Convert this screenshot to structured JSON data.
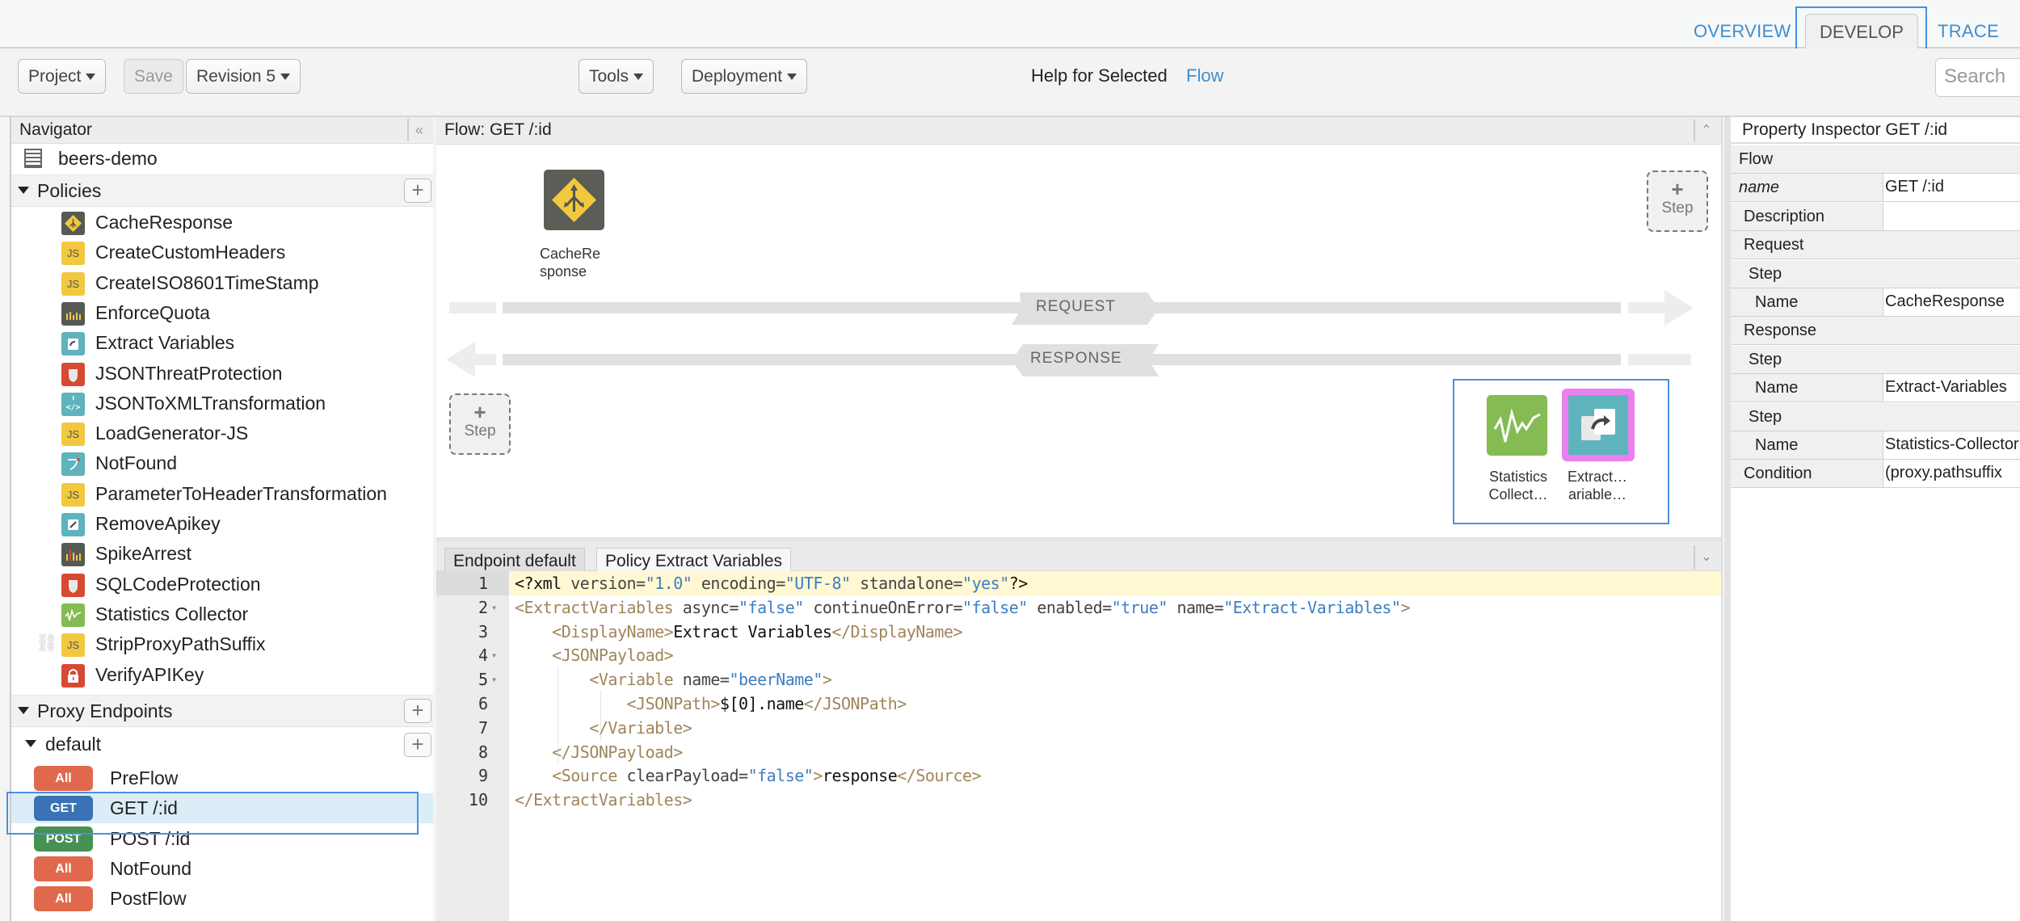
{
  "top_tabs": {
    "overview": "OVERVIEW",
    "develop": "DEVELOP",
    "trace": "TRACE",
    "active": "DEVELOP"
  },
  "toolbar": {
    "project": "Project",
    "save": "Save",
    "revision": "Revision 5",
    "tools": "Tools",
    "deployment": "Deployment",
    "help_label": "Help for Selected",
    "help_link": "Flow",
    "search_placeholder": "Search"
  },
  "navigator": {
    "title": "Navigator",
    "proxy_name": "beers-demo",
    "policies_label": "Policies",
    "policies": [
      {
        "label": "CacheResponse",
        "icon": "cache-response-icon"
      },
      {
        "label": "CreateCustomHeaders",
        "icon": "javascript-icon"
      },
      {
        "label": "CreateISO8601TimeStamp",
        "icon": "javascript-icon"
      },
      {
        "label": "EnforceQuota",
        "icon": "quota-icon"
      },
      {
        "label": "Extract Variables",
        "icon": "extract-variables-icon"
      },
      {
        "label": "JSONThreatProtection",
        "icon": "shield-icon"
      },
      {
        "label": "JSONToXMLTransformation",
        "icon": "code-transform-icon"
      },
      {
        "label": "LoadGenerator-JS",
        "icon": "javascript-icon"
      },
      {
        "label": "NotFound",
        "icon": "raise-fault-icon"
      },
      {
        "label": "ParameterToHeaderTransformation",
        "icon": "javascript-icon"
      },
      {
        "label": "RemoveApikey",
        "icon": "assign-message-icon"
      },
      {
        "label": "SpikeArrest",
        "icon": "spike-arrest-icon"
      },
      {
        "label": "SQLCodeProtection",
        "icon": "shield-icon"
      },
      {
        "label": "Statistics Collector",
        "icon": "statistics-icon"
      },
      {
        "label": "StripProxyPathSuffix",
        "icon": "javascript-icon"
      },
      {
        "label": "VerifyAPIKey",
        "icon": "lock-icon"
      }
    ],
    "proxy_endpoints_label": "Proxy Endpoints",
    "endpoint_name": "default",
    "flows": [
      {
        "verb": "All",
        "label": "PreFlow"
      },
      {
        "verb": "GET",
        "label": "GET /:id",
        "selected": true
      },
      {
        "verb": "POST",
        "label": "POST /:id"
      },
      {
        "verb": "All",
        "label": "NotFound"
      },
      {
        "verb": "All",
        "label": "PostFlow"
      }
    ]
  },
  "flow_panel": {
    "title": "Flow: GET /:id",
    "request_label": "REQUEST",
    "response_label": "RESPONSE",
    "step_label": "Step",
    "request_steps": [
      {
        "label_line1": "CacheRe",
        "label_line2": "sponse"
      }
    ],
    "response_steps": [
      {
        "label_line1": "Statistics",
        "label_line2": "Collect…"
      },
      {
        "label_line1": "Extract…",
        "label_line2": "ariable…",
        "selected": true
      }
    ]
  },
  "editor": {
    "tabs": [
      "Endpoint default",
      "Policy Extract Variables"
    ],
    "active_tab": "Policy Extract Variables",
    "lines": [
      "<?xml version=\"1.0\" encoding=\"UTF-8\" standalone=\"yes\"?>",
      "<ExtractVariables async=\"false\" continueOnError=\"false\" enabled=\"true\" name=\"Extract-Variables\">",
      "    <DisplayName>Extract Variables</DisplayName>",
      "    <JSONPayload>",
      "        <Variable name=\"beerName\">",
      "            <JSONPath>$[0].name</JSONPath>",
      "        </Variable>",
      "    </JSONPayload>",
      "    <Source clearPayload=\"false\">response</Source>",
      "</ExtractVariables>"
    ]
  },
  "inspector": {
    "title": "Property Inspector  GET /:id",
    "rows": [
      {
        "key": "Flow",
        "value": null
      },
      {
        "key": "name",
        "value": "GET /:id",
        "italic": true
      },
      {
        "key": "Description",
        "value": ""
      },
      {
        "key": "Request",
        "value": null
      },
      {
        "key": "Step",
        "value": null
      },
      {
        "key": "Name",
        "value": "CacheResponse"
      },
      {
        "key": "Response",
        "value": null
      },
      {
        "key": "Step",
        "value": null
      },
      {
        "key": "Name",
        "value": "Extract-Variables"
      },
      {
        "key": "Step",
        "value": null
      },
      {
        "key": "Name",
        "value": "Statistics-Collector"
      },
      {
        "key": "Condition",
        "value": "(proxy.pathsuffix"
      }
    ]
  },
  "colors": {
    "accent": "#3c8fcf",
    "selection": "#4a90e2",
    "verb_all": "#e0694d",
    "verb_get": "#3a72b5",
    "verb_post": "#479152",
    "selected_step_border": "#ea7ff0"
  }
}
